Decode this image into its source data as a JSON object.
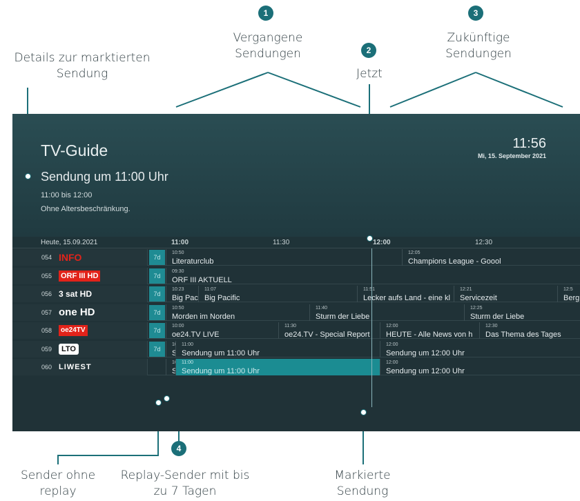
{
  "annotations": {
    "details": "Details zur marktierten Sendung",
    "past": "Vergangene Sendungen",
    "now": "Jetzt",
    "future": "Zukünftige Sendungen",
    "no_replay": "Sender ohne replay",
    "replay": "Replay-Sender mit bis zu 7 Tagen",
    "marked": "Markierte Sendung",
    "numbers": [
      "1",
      "2",
      "3",
      "4"
    ]
  },
  "header": {
    "title": "TV-Guide",
    "selected_title": "Sendung um 11:00 Uhr",
    "selected_time": "11:00 bis 12:00",
    "selected_age": "Ohne Altersbeschränkung.",
    "clock": "11:56",
    "date": "Mi, 15. September 2021"
  },
  "timeline": {
    "date_label": "Heute, 15.09.2021",
    "times": [
      "11:00",
      "11:30",
      "12:00",
      "12:30"
    ]
  },
  "channels": [
    {
      "num": "054",
      "logo": "INFO",
      "replay": "7d"
    },
    {
      "num": "055",
      "logo": "ORF III HD",
      "replay": "7d"
    },
    {
      "num": "056",
      "logo": "3 sat HD",
      "replay": "7d"
    },
    {
      "num": "057",
      "logo": "one HD",
      "replay": "7d"
    },
    {
      "num": "058",
      "logo": "oe24TV",
      "replay": "7d"
    },
    {
      "num": "059",
      "logo": "LTO",
      "replay": "7d"
    },
    {
      "num": "060",
      "logo": "LIWEST",
      "replay": ""
    }
  ],
  "programs": [
    [
      {
        "time": "10:50",
        "title": "Literaturclub"
      },
      {
        "time": "12:05",
        "title": "Champions League - Goool"
      }
    ],
    [
      {
        "time": "09:30",
        "title": "ORF III AKTUELL"
      }
    ],
    [
      {
        "time": "10:23",
        "title": "Big Paci"
      },
      {
        "time": "11:07",
        "title": "Big Pacific"
      },
      {
        "time": "11:51",
        "title": "Lecker aufs Land - eine kl"
      },
      {
        "time": "12:21",
        "title": "Servicezeit"
      },
      {
        "time": "12:5",
        "title": "Berg"
      }
    ],
    [
      {
        "time": "10:50",
        "title": "Morden im Norden"
      },
      {
        "time": "11:40",
        "title": "Sturm der Liebe"
      },
      {
        "time": "12:25",
        "title": "Sturm der Liebe"
      }
    ],
    [
      {
        "time": "10:00",
        "title": "oe24.TV LIVE"
      },
      {
        "time": "11:30",
        "title": "oe24.TV - Special Report"
      },
      {
        "time": "12:00",
        "title": "HEUTE - Alle News von h"
      },
      {
        "time": "12:30",
        "title": "Das Thema des Tages"
      }
    ],
    [
      {
        "time": "10",
        "title": "S"
      },
      {
        "time": "11:00",
        "title": "Sendung um 11:00 Uhr"
      },
      {
        "time": "12:00",
        "title": "Sendung um 12:00 Uhr"
      }
    ],
    [
      {
        "time": "10",
        "title": "S"
      },
      {
        "time": "11:00",
        "title": "Sendung um 11:00 Uhr"
      },
      {
        "time": "12:00",
        "title": "Sendung um 12:00 Uhr"
      }
    ]
  ],
  "colors": {
    "accent": "#1b6f78",
    "highlight": "#1b8c92",
    "brand_red": "#e2231a"
  }
}
